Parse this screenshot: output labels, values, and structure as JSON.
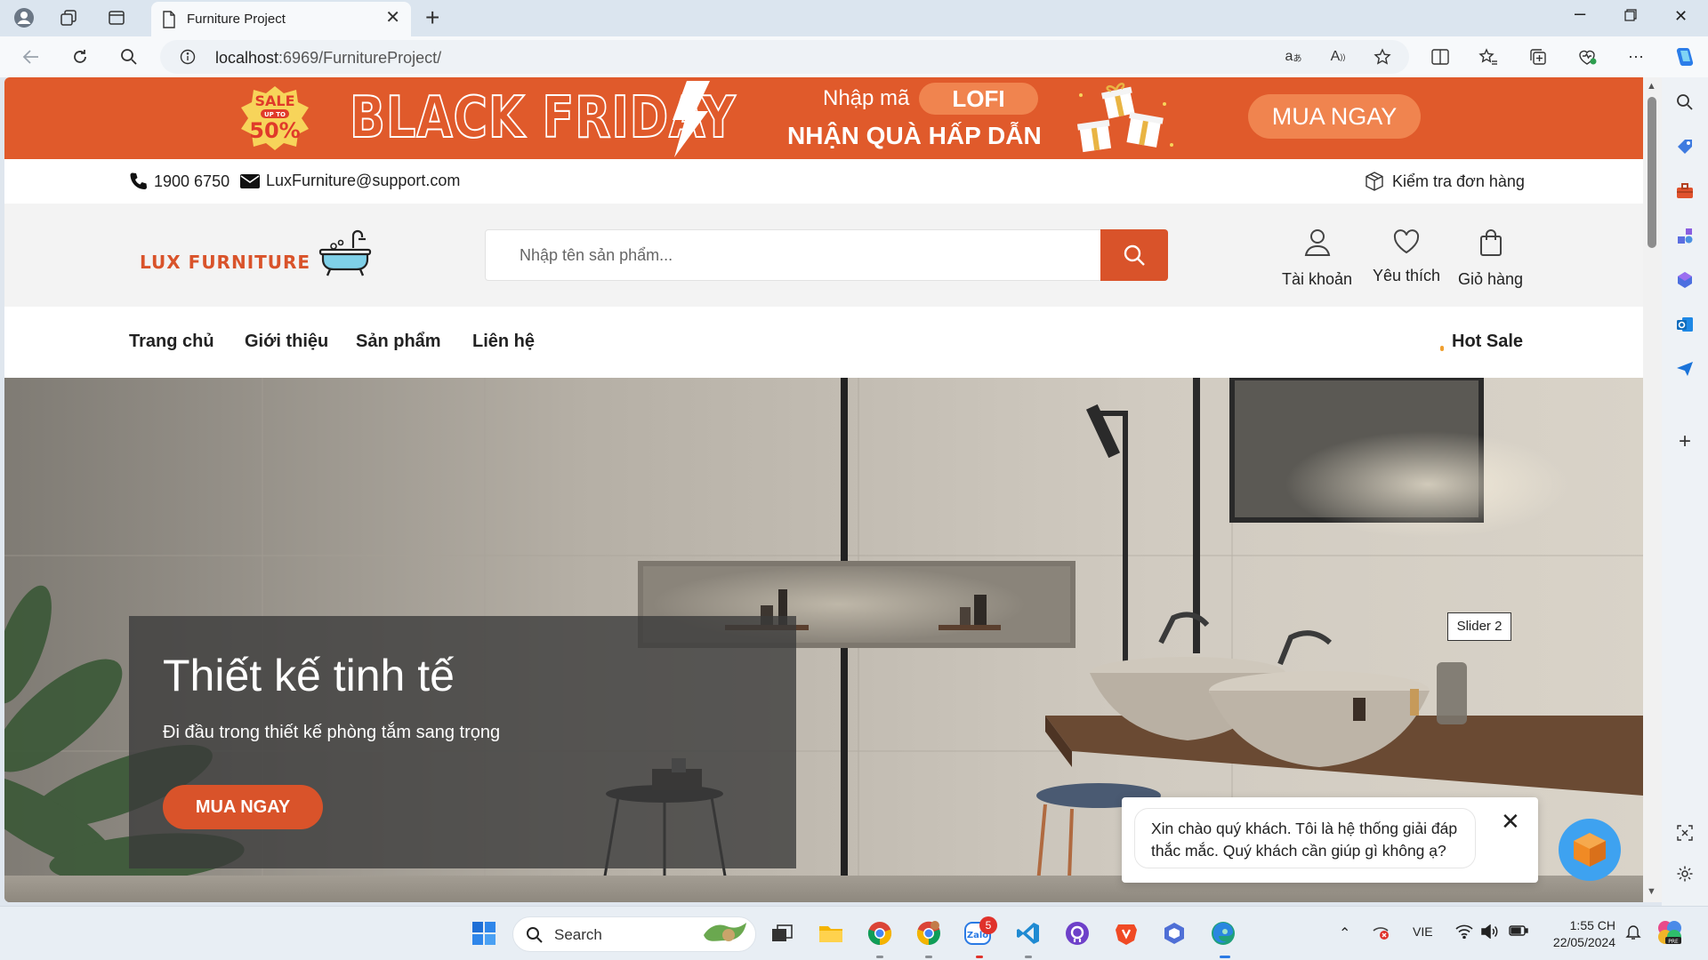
{
  "browser": {
    "tab_title": "Furniture Project",
    "url_host": "localhost",
    "url_path": ":6969/FurnitureProject/"
  },
  "banner": {
    "sale_badge_top": "SALE",
    "sale_badge_mid": "UP TO",
    "sale_badge_value": "50%",
    "headline": "BLACK FRIDAY",
    "code_prefix": "Nhập mã",
    "code": "LOFI",
    "promo_text": "NHẬN QUÀ HẤP DẪN",
    "cta": "MUA NGAY"
  },
  "topbar": {
    "phone": "1900 6750",
    "email": "LuxFurniture@support.com",
    "order_check": "Kiểm tra đơn hàng"
  },
  "header": {
    "logo_text": "LUX FURNITURE",
    "search_placeholder": "Nhập tên sản phẩm...",
    "account": "Tài khoản",
    "wishlist": "Yêu thích",
    "cart": "Giỏ hàng"
  },
  "nav": {
    "items": [
      "Trang chủ",
      "Giới thiệu",
      "Sản phẩm",
      "Liên hệ"
    ],
    "hot_sale": "Hot Sale"
  },
  "hero": {
    "title": "Thiết kế tinh tế",
    "subtitle": "Đi đầu trong thiết kế phòng tắm sang trọng",
    "cta": "MUA NGAY",
    "slider_label": "Slider 2"
  },
  "chat": {
    "message": "Xin chào quý khách. Tôi là hệ thống giải đáp thắc mắc. Quý khách cần giúp gì không ạ?"
  },
  "taskbar": {
    "search_label": "Search",
    "language": "VIE",
    "time": "1:55 CH",
    "date": "22/05/2024",
    "zalo_badge": "5"
  },
  "colors": {
    "brand": "#d9532a",
    "banner_bg": "#e05a2b",
    "accent_light": "#f0844f"
  }
}
